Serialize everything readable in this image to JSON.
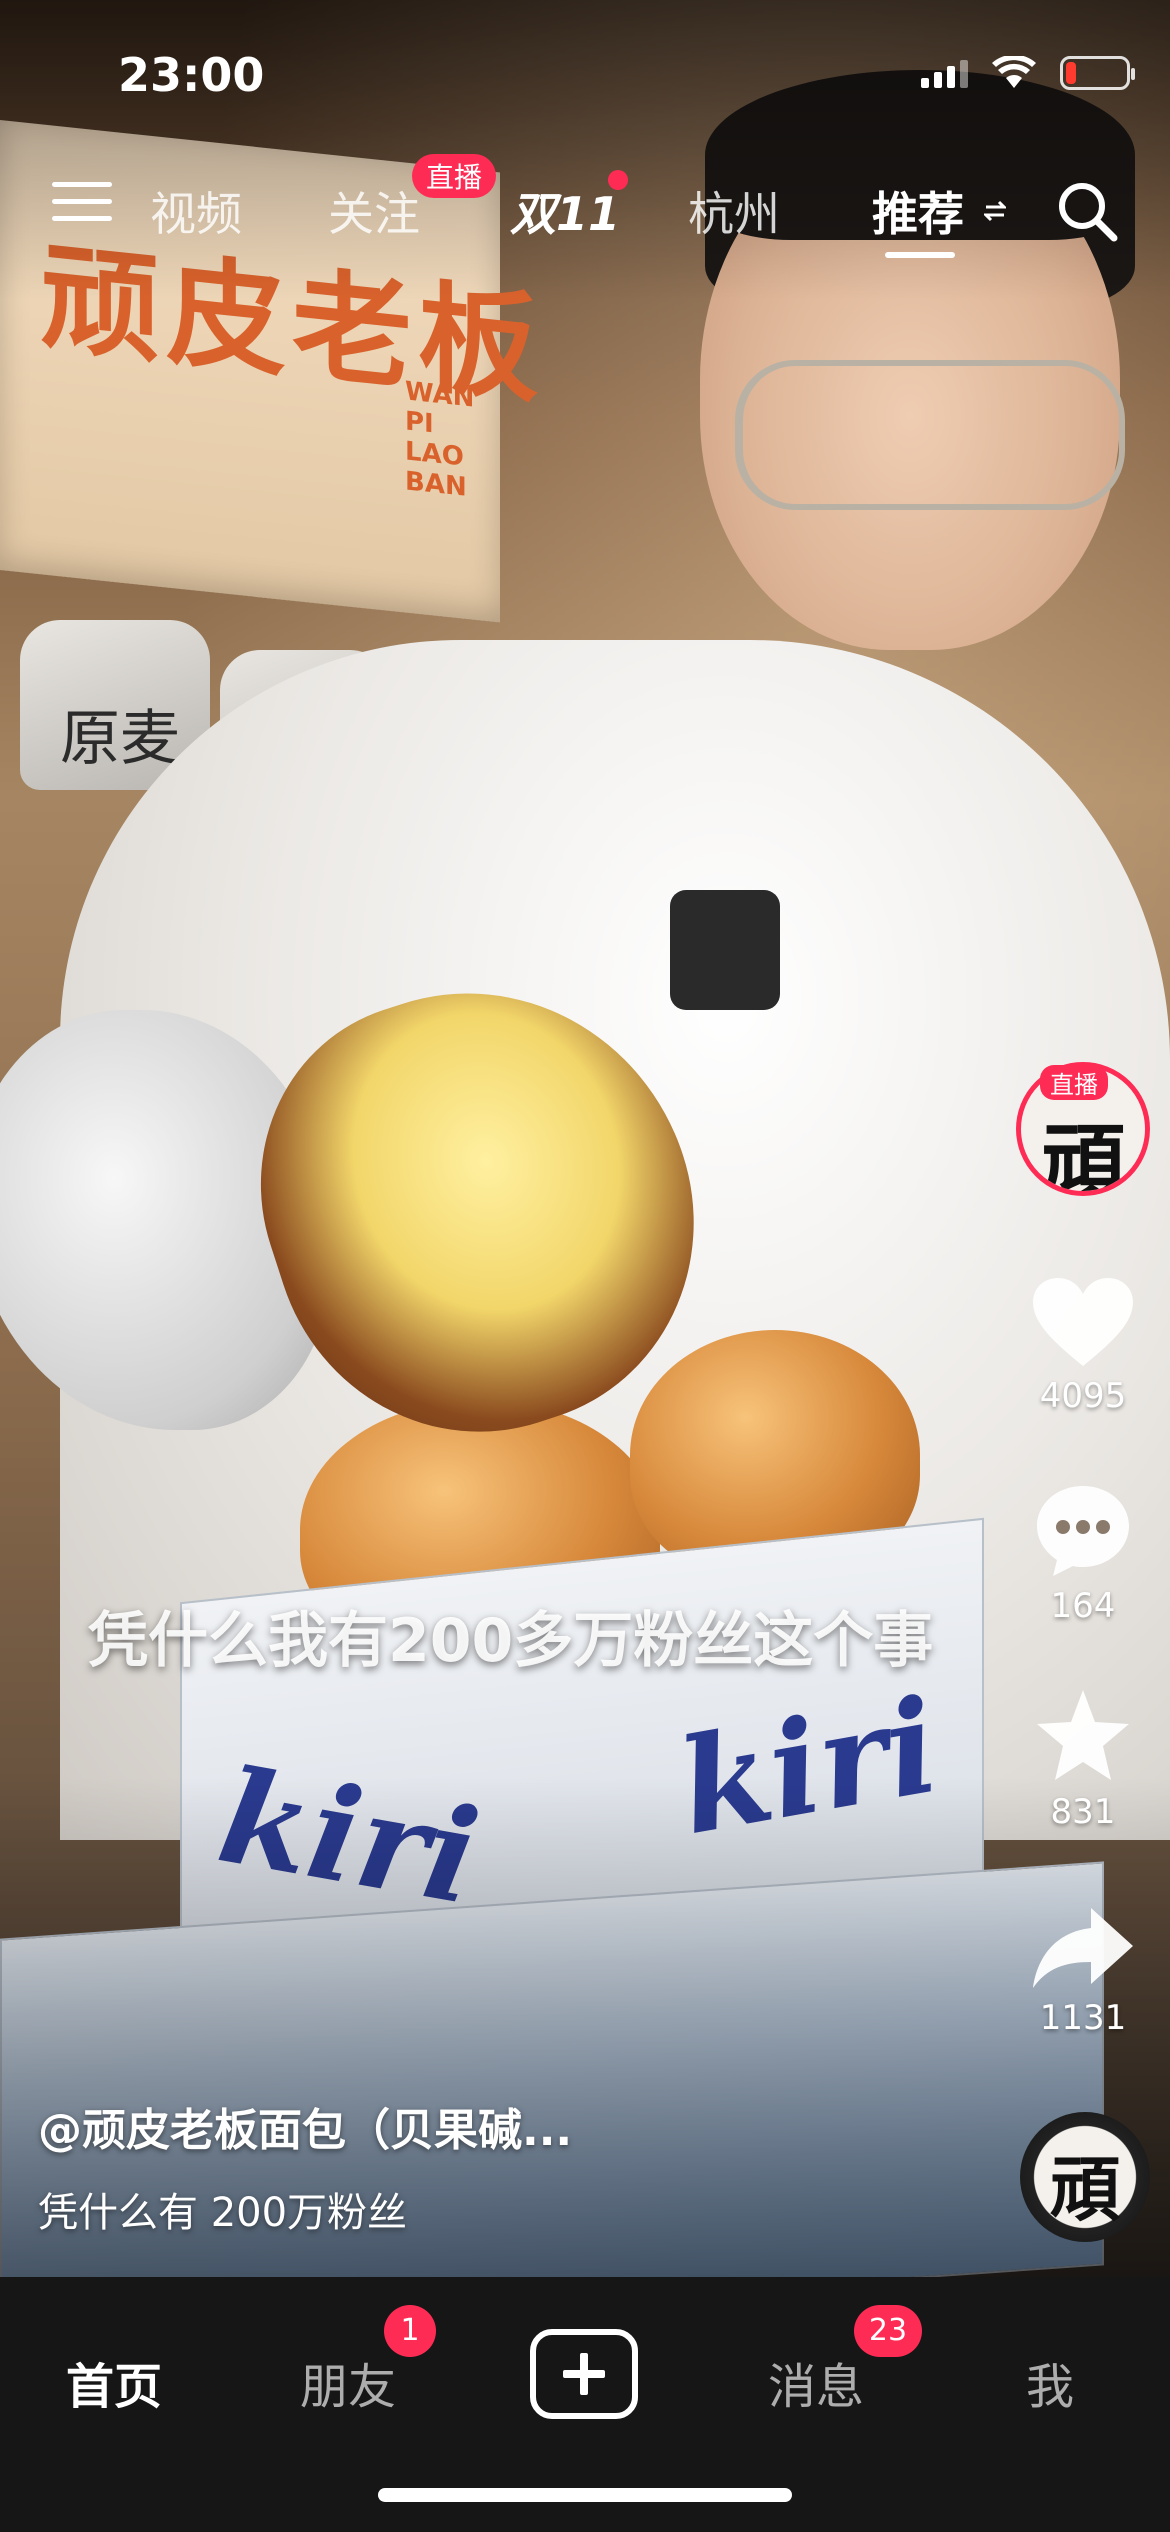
{
  "status_bar": {
    "time": "23:00",
    "battery_level": 0.18,
    "battery_color": "#ff3b30"
  },
  "top_nav": {
    "menu_icon": "menu-icon",
    "tabs": [
      {
        "label": "视频",
        "active": false
      },
      {
        "label": "关注",
        "active": false,
        "badge": "直播"
      },
      {
        "label": "双11",
        "active": false,
        "dot": true
      },
      {
        "label": "杭州",
        "active": false
      },
      {
        "label": "推荐",
        "active": true
      }
    ],
    "search_icon": "search-icon"
  },
  "video": {
    "sign_text": "顽皮老板",
    "sign_subtext": "WAN PI LAO BAN",
    "sack_text_1": "原麦",
    "box_brand": "kiri",
    "caption": "凭什么我有200多万粉丝这个事"
  },
  "side_actions": {
    "avatar_live_badge": "直播",
    "avatar_glyph": "頑",
    "like_count": "4095",
    "comment_count": "164",
    "favorite_count": "831",
    "share_count": "1131",
    "music_glyph": "頑"
  },
  "post": {
    "author": "@顽皮老板面包（贝果碱...",
    "description": "凭什么有 200万粉丝"
  },
  "tab_bar": {
    "home": "首页",
    "friends": "朋友",
    "friends_badge": "1",
    "messages": "消息",
    "messages_badge": "23",
    "me": "我"
  },
  "colors": {
    "accent": "#fe2c55",
    "tabbar_bg": "#161616"
  }
}
